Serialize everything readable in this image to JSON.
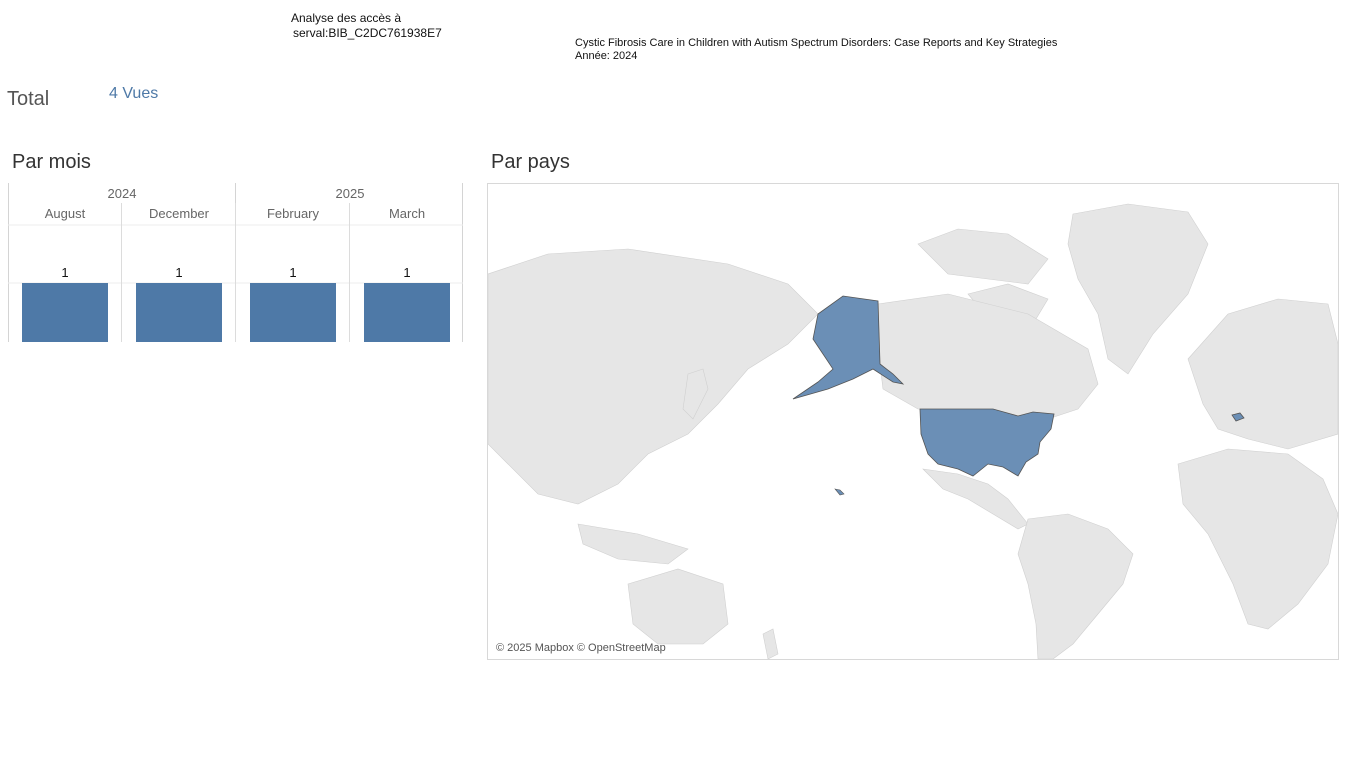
{
  "header": {
    "analysis_line1": "Analyse des accès à",
    "analysis_line2": "serval:BIB_C2DC761938E7",
    "doc_title": "Cystic Fibrosis Care in Children with Autism Spectrum Disorders: Case Reports and Key Strategies",
    "doc_year": "Année: 2024"
  },
  "summary": {
    "total_label": "Total",
    "total_value": "4 Vues"
  },
  "sections": {
    "by_month": "Par mois",
    "by_country": "Par pays"
  },
  "chart_data": {
    "type": "bar",
    "years": [
      {
        "year": "2024",
        "months": [
          "August",
          "December"
        ]
      },
      {
        "year": "2025",
        "months": [
          "February",
          "March"
        ]
      }
    ],
    "categories": [
      "August",
      "December",
      "February",
      "March"
    ],
    "values": [
      1,
      1,
      1,
      1
    ],
    "ylim": [
      0,
      1
    ],
    "bar_color": "#4e79a7",
    "data_labels": true
  },
  "map": {
    "highlighted_countries": [
      "United States",
      "Switzerland"
    ],
    "highlight_color": "#4e79a7",
    "attribution": "© 2025 Mapbox © OpenStreetMap"
  }
}
